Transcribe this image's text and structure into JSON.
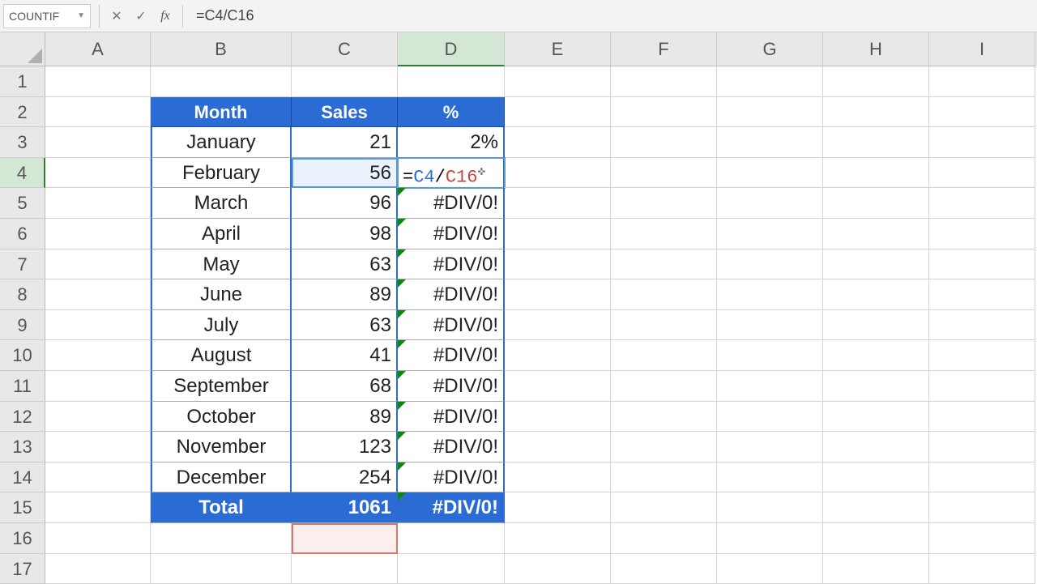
{
  "name_box": "COUNTIF",
  "formula": "=C4/C16",
  "formula_parts": {
    "eq": "=",
    "r1": "C4",
    "slash": "/",
    "r2": "C16"
  },
  "cursor_glyph": "✜",
  "columns": [
    "A",
    "B",
    "C",
    "D",
    "E",
    "F",
    "G",
    "H",
    "I"
  ],
  "rows": [
    "1",
    "2",
    "3",
    "4",
    "5",
    "6",
    "7",
    "8",
    "9",
    "10",
    "11",
    "12",
    "13",
    "14",
    "15",
    "16",
    "17"
  ],
  "headers": {
    "month": "Month",
    "sales": "Sales",
    "pct": "%"
  },
  "data": [
    {
      "month": "January",
      "sales": "21",
      "pct": "2%"
    },
    {
      "month": "February",
      "sales": "56",
      "pct": "EDIT"
    },
    {
      "month": "March",
      "sales": "96",
      "pct": "#DIV/0!"
    },
    {
      "month": "April",
      "sales": "98",
      "pct": "#DIV/0!"
    },
    {
      "month": "May",
      "sales": "63",
      "pct": "#DIV/0!"
    },
    {
      "month": "June",
      "sales": "89",
      "pct": "#DIV/0!"
    },
    {
      "month": "July",
      "sales": "63",
      "pct": "#DIV/0!"
    },
    {
      "month": "August",
      "sales": "41",
      "pct": "#DIV/0!"
    },
    {
      "month": "September",
      "sales": "68",
      "pct": "#DIV/0!"
    },
    {
      "month": "October",
      "sales": "89",
      "pct": "#DIV/0!"
    },
    {
      "month": "November",
      "sales": "123",
      "pct": "#DIV/0!"
    },
    {
      "month": "December",
      "sales": "254",
      "pct": "#DIV/0!"
    }
  ],
  "total": {
    "label": "Total",
    "sales": "1061",
    "pct": "#DIV/0!"
  },
  "icons": {
    "cancel": "✕",
    "accept": "✓",
    "fx": "fx"
  }
}
